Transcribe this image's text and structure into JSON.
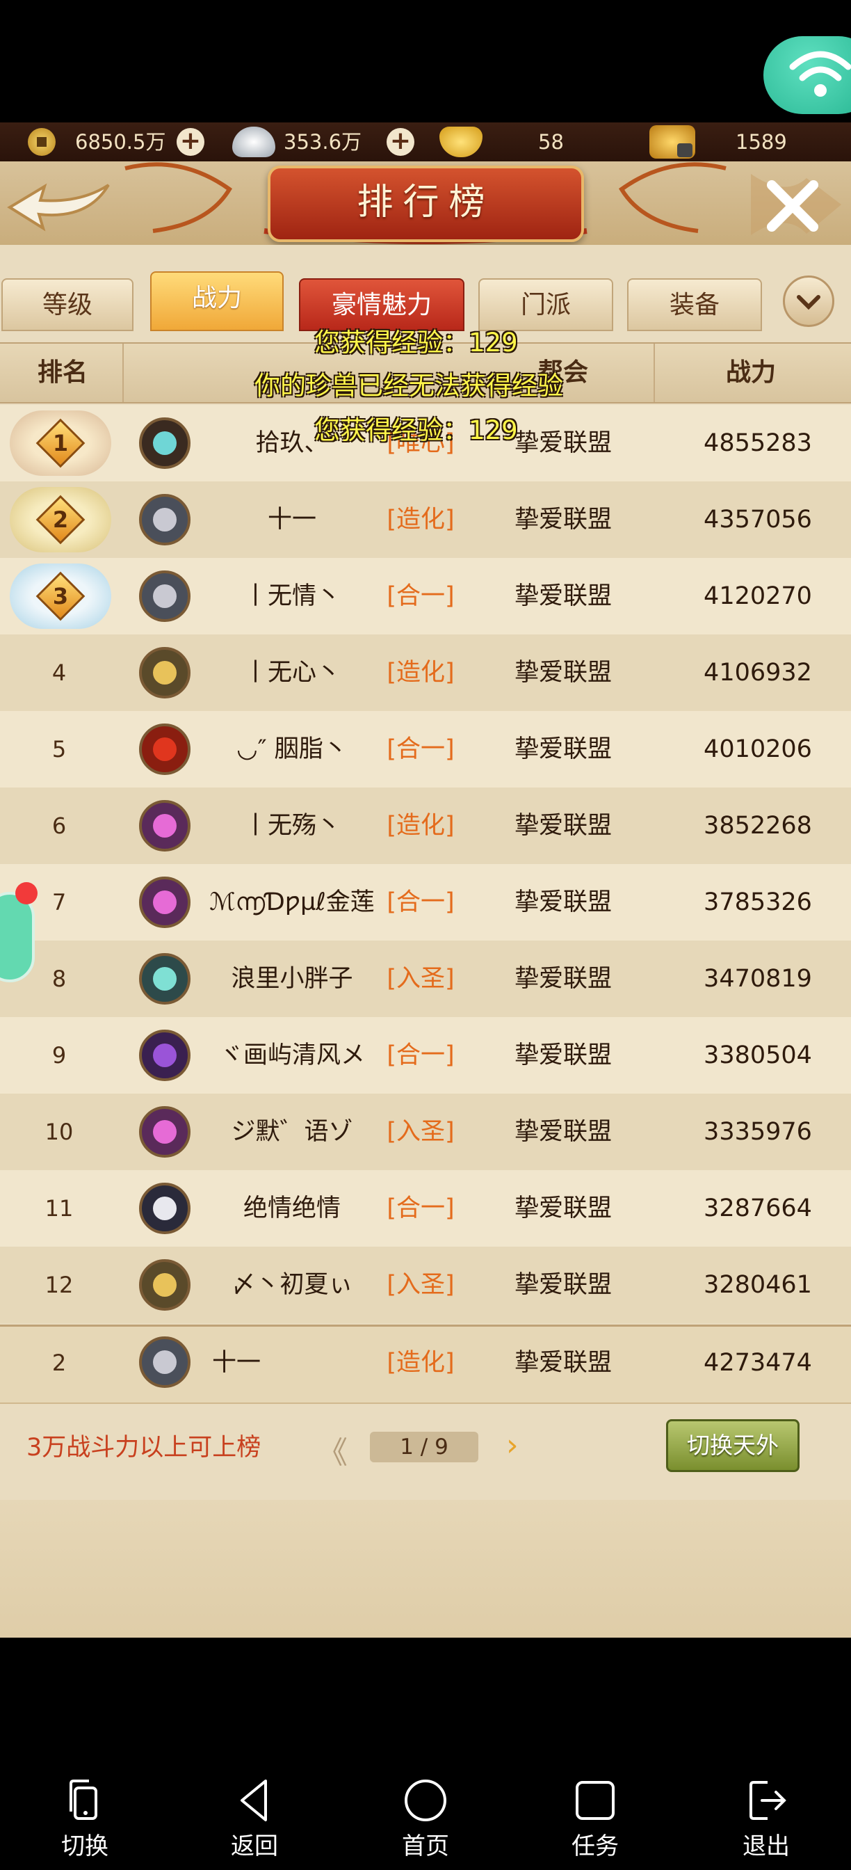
{
  "currency": {
    "copper": "6850.5万",
    "silver": "353.6万",
    "gold": "58",
    "bound_gold": "1589"
  },
  "title": "排行榜",
  "tabs": [
    {
      "label": "等级"
    },
    {
      "label": "战力"
    },
    {
      "label": "豪情魅力"
    },
    {
      "label": "门派"
    },
    {
      "label": "装备"
    }
  ],
  "columns": [
    "排名",
    "",
    "",
    "帮会",
    "战力"
  ],
  "rows": [
    {
      "rank": "1",
      "name": "拾玖、",
      "realm": "[唯心]",
      "guild": "挚爱联盟",
      "power": "4855283"
    },
    {
      "rank": "2",
      "name": "十一",
      "realm": "[造化]",
      "guild": "挚爱联盟",
      "power": "4357056"
    },
    {
      "rank": "3",
      "name": "丨无情丶",
      "realm": "[合一]",
      "guild": "挚爱联盟",
      "power": "4120270"
    },
    {
      "rank": "4",
      "name": "丨无心丶",
      "realm": "[造化]",
      "guild": "挚爱联盟",
      "power": "4106932"
    },
    {
      "rank": "5",
      "name": "◡″ 胭脂丶",
      "realm": "[合一]",
      "guild": "挚爱联盟",
      "power": "4010206"
    },
    {
      "rank": "6",
      "name": "丨无殇丶",
      "realm": "[造化]",
      "guild": "挚爱联盟",
      "power": "3852268"
    },
    {
      "rank": "7",
      "name": "ℳ൬Ɗƿµℓ金莲",
      "realm": "[合一]",
      "guild": "挚爱联盟",
      "power": "3785326"
    },
    {
      "rank": "8",
      "name": "浪里小胖子",
      "realm": "[入圣]",
      "guild": "挚爱联盟",
      "power": "3470819"
    },
    {
      "rank": "9",
      "name": "ヾ画屿清风メ",
      "realm": "[合一]",
      "guild": "挚爱联盟",
      "power": "3380504"
    },
    {
      "rank": "10",
      "name": "ジ默゛语ゾ",
      "realm": "[入圣]",
      "guild": "挚爱联盟",
      "power": "3335976"
    },
    {
      "rank": "11",
      "name": "绝情绝情",
      "realm": "[合一]",
      "guild": "挚爱联盟",
      "power": "3287664"
    },
    {
      "rank": "12",
      "name": "〆丶初夏ぃ",
      "realm": "[入圣]",
      "guild": "挚爱联盟",
      "power": "3280461"
    }
  ],
  "my_row": {
    "rank": "2",
    "name": "十一",
    "realm": "[造化]",
    "guild": "挚爱联盟",
    "power": "4273474"
  },
  "footer": {
    "hint": "3万战斗力以上可上榜",
    "prev": "《",
    "page": "1 / 9",
    "next": "›",
    "switch_label": "切换天外"
  },
  "overlay": {
    "msg1": "您获得经验：129",
    "msg2": "你的珍兽已经无法获得经验",
    "msg3": "您获得经验：129"
  },
  "nav": [
    {
      "label": "切换",
      "icon": "phone-switch-icon"
    },
    {
      "label": "返回",
      "icon": "back-triangle-icon"
    },
    {
      "label": "首页",
      "icon": "home-circle-icon"
    },
    {
      "label": "任务",
      "icon": "task-square-icon"
    },
    {
      "label": "退出",
      "icon": "exit-icon"
    }
  ]
}
